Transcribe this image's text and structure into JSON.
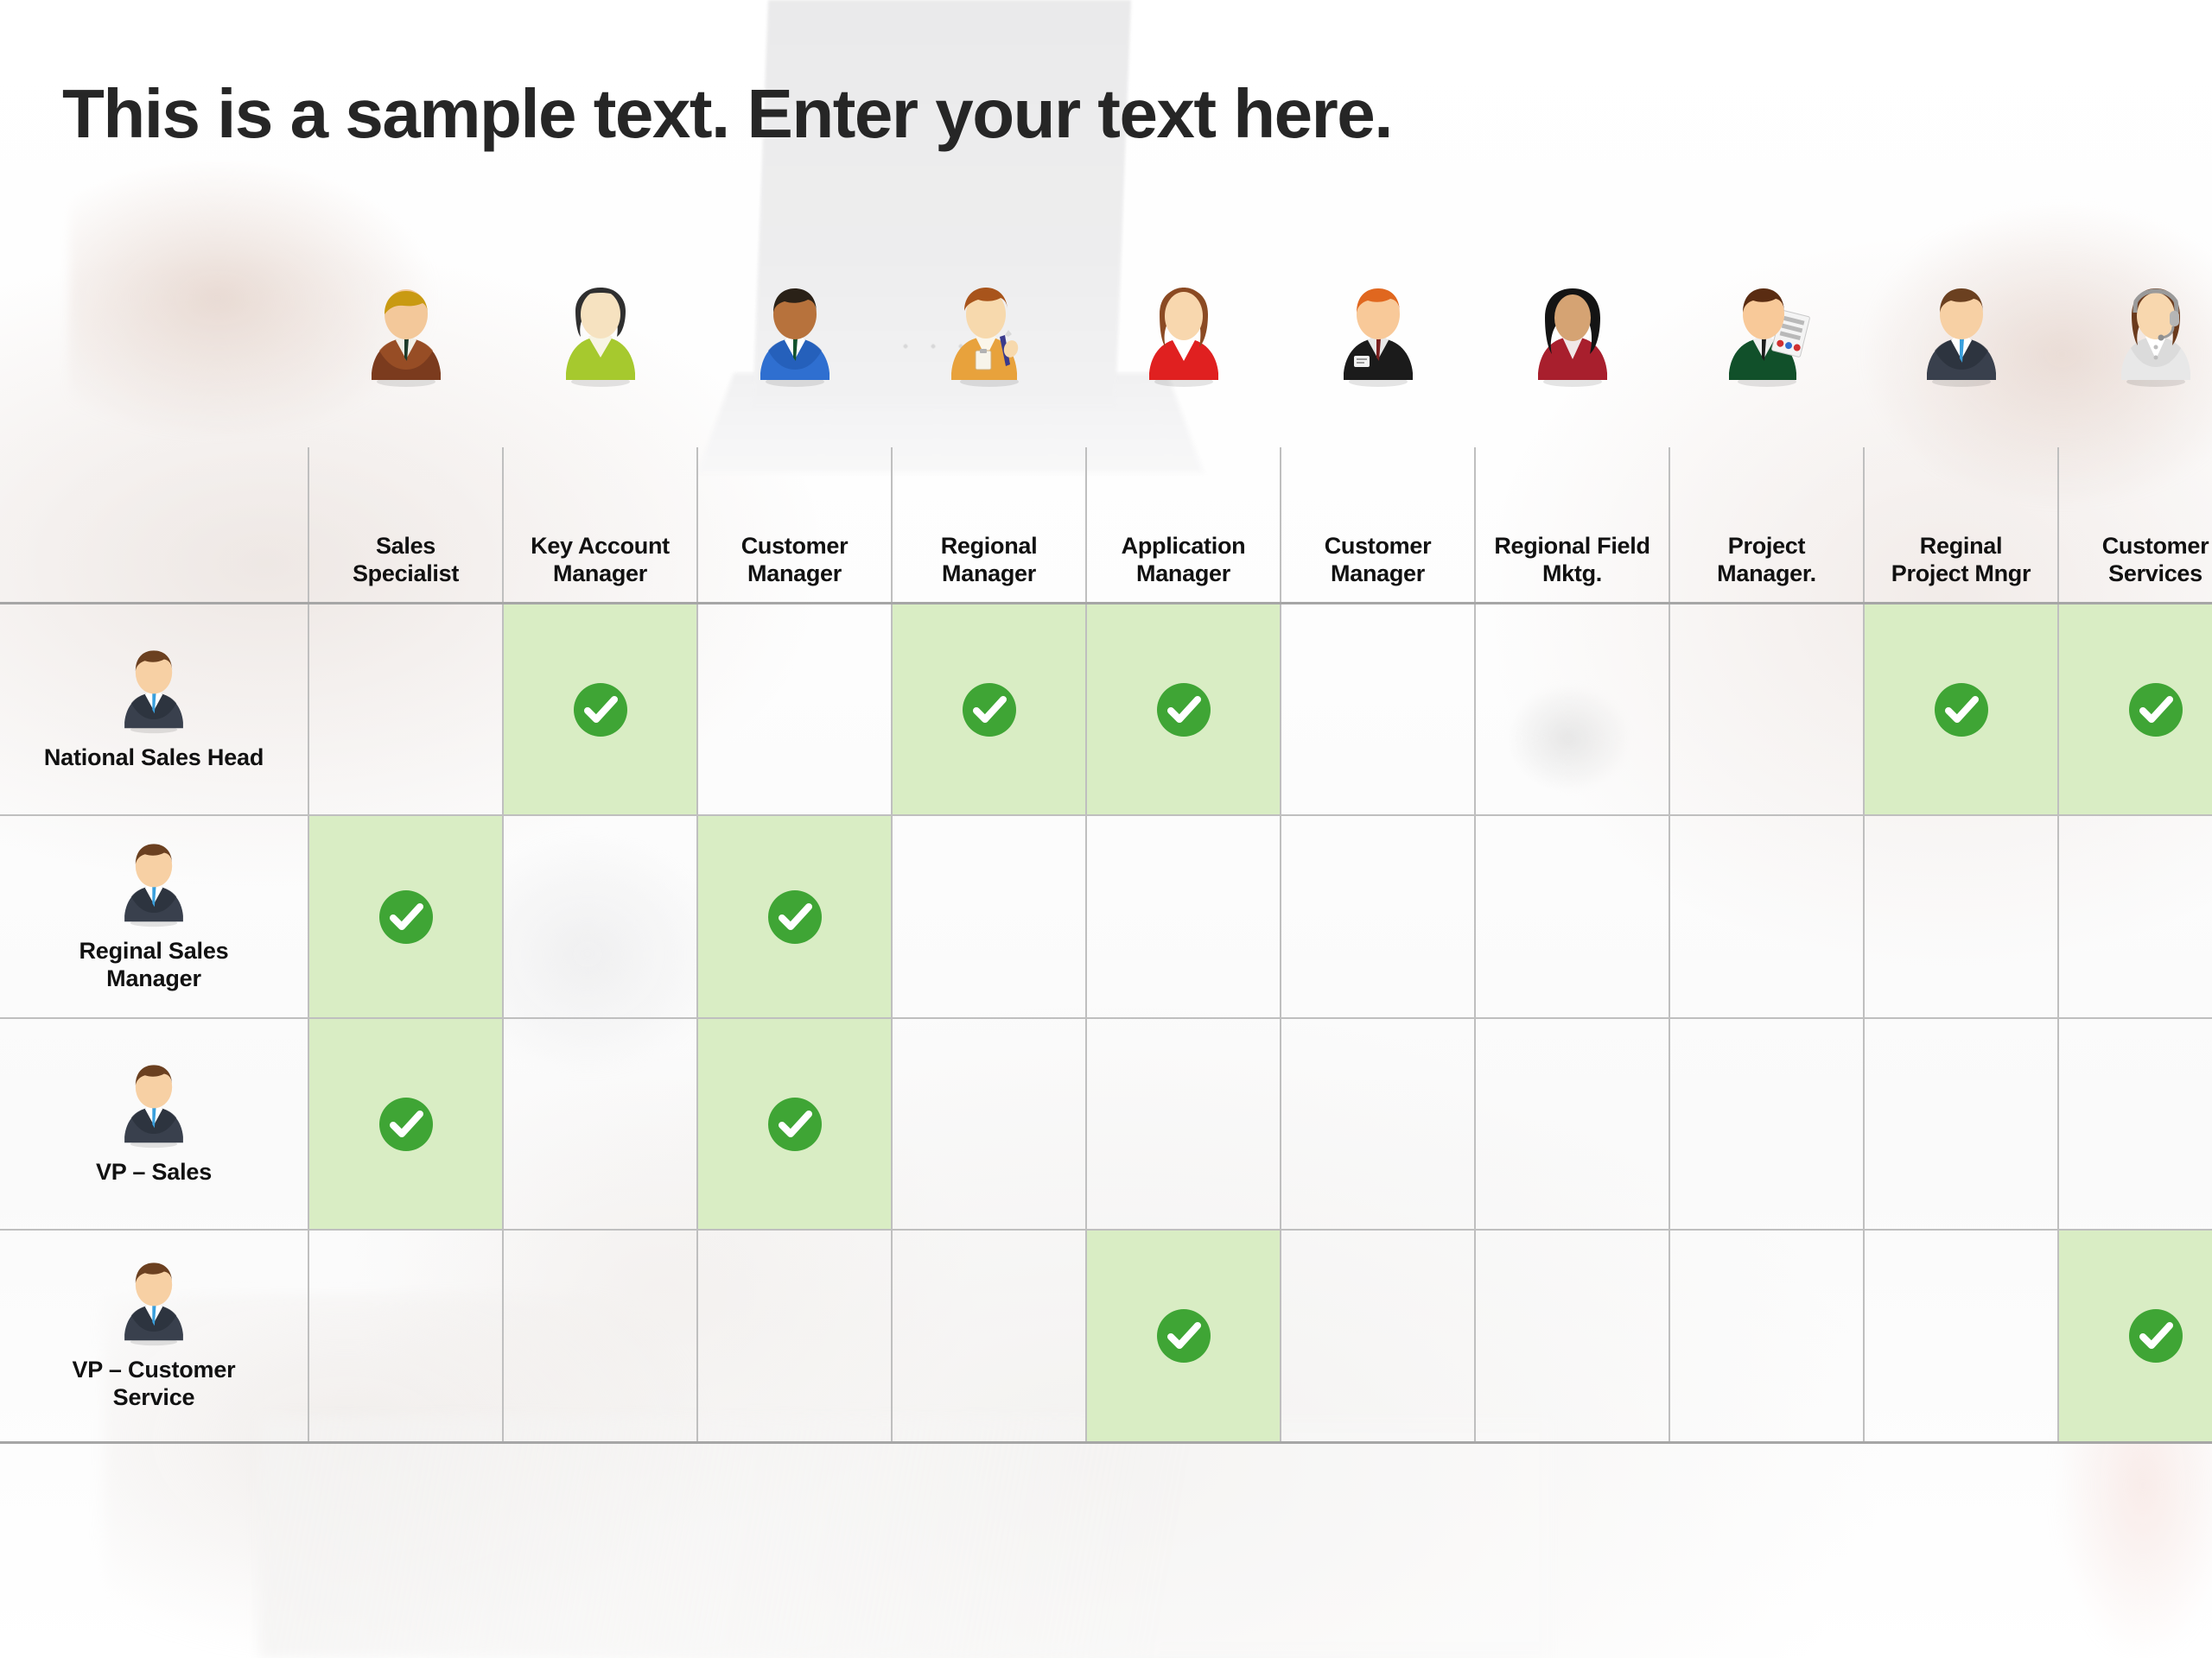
{
  "slide": {
    "title": "This is a sample text. Enter your text here."
  },
  "matrix": {
    "columns": [
      {
        "label": "Sales\nSpecialist",
        "label_line1": "Sales",
        "label_line2": "Specialist",
        "icon": "person-male-brown-suit-icon",
        "hair": "#c99a12",
        "suit": "#7b3b1e",
        "suit2": "#a05428",
        "shirt": "#f2efe6",
        "tie": "#1d3b2a",
        "skin": "#f3c89a"
      },
      {
        "label": "Key Account\nManager",
        "label_line1": "Key Account",
        "label_line2": "Manager",
        "icon": "person-female-green-top-icon",
        "hair": "#2f2f2f",
        "suit": "#a6c92e",
        "suit2": "#8fb223",
        "shirt": "#f7f4e4",
        "tie": "",
        "skin": "#f6e2c0"
      },
      {
        "label": "Customer\nManager",
        "label_line1": "Customer",
        "label_line2": "Manager",
        "icon": "person-male-blue-suit-icon",
        "hair": "#2a2117",
        "suit": "#2f6fd0",
        "suit2": "#1f57ad",
        "shirt": "#ffffff",
        "tie": "#14532d",
        "skin": "#b7723c"
      },
      {
        "label": "Regional\nManager",
        "label_line1": "Regional",
        "label_line2": "Manager",
        "icon": "person-female-clipboard-icon",
        "hair": "#a8541b",
        "suit": "#e8a23c",
        "suit2": "#cf8b28",
        "shirt": "#fbf6ea",
        "tie": "",
        "skin": "#f7d9ad"
      },
      {
        "label": "Application\nManager",
        "label_line1": "Application",
        "label_line2": "Manager",
        "icon": "person-female-red-top-icon",
        "hair": "#8b4a23",
        "suit": "#e02020",
        "suit2": "#b81616",
        "shirt": "#ffffff",
        "tie": "",
        "skin": "#f8d7ae"
      },
      {
        "label": "Customer\nManager",
        "label_line1": "Customer",
        "label_line2": "Manager",
        "icon": "person-male-black-suit-badge-icon",
        "hair": "#e0671f",
        "suit": "#1b1b1b",
        "suit2": "#000000",
        "shirt": "#e8e8e8",
        "tie": "#7a1f1f",
        "skin": "#f8c999"
      },
      {
        "label": "Regional Field\nMktg.",
        "label_line1": "Regional Field",
        "label_line2": "Mktg.",
        "icon": "person-female-dark-hair-icon",
        "hair": "#141414",
        "suit": "#a81f2d",
        "suit2": "#7d1420",
        "shirt": "#f0e7e7",
        "tie": "",
        "skin": "#d5a373"
      },
      {
        "label": "Project\nManager.",
        "label_line1": "Project",
        "label_line2": "Manager.",
        "icon": "person-male-green-suit-chart-icon",
        "hair": "#5a2c12",
        "suit": "#11502a",
        "suit2": "#0b3b1e",
        "shirt": "#efefef",
        "tie": "#1c1c1c",
        "skin": "#f8c999"
      },
      {
        "label": "Reginal\nProject Mngr",
        "label_line1": "Reginal",
        "label_line2": "Project Mngr",
        "icon": "person-male-navy-suit-icon",
        "hair": "#6b4020",
        "suit": "#39404d",
        "suit2": "#242a34",
        "shirt": "#ffffff",
        "tie": "#3aa0dd",
        "skin": "#f7d0a4"
      },
      {
        "label": "Customer\nServices",
        "label_line1": "Customer",
        "label_line2": "Services",
        "icon": "person-female-headset-icon",
        "hair": "#6b3a1c",
        "suit": "#e8e8e8",
        "suit2": "#cfcfcf",
        "shirt": "#ffffff",
        "tie": "",
        "skin": "#f8d7ae"
      }
    ],
    "rows": [
      {
        "label": "National Sales Head",
        "label_line1": "National Sales Head",
        "label_line2": "",
        "icon": "person-male-navy-suit-icon"
      },
      {
        "label": "Reginal Sales Manager",
        "label_line1": "Reginal Sales",
        "label_line2": "Manager",
        "icon": "person-male-navy-suit-icon"
      },
      {
        "label": "VP – Sales",
        "label_line1": "VP – Sales",
        "label_line2": "",
        "icon": "person-male-navy-suit-icon"
      },
      {
        "label": "VP – Customer Service",
        "label_line1": "VP – Customer",
        "label_line2": "Service",
        "icon": "person-male-navy-suit-icon"
      }
    ],
    "cells": [
      [
        false,
        true,
        false,
        true,
        true,
        false,
        false,
        false,
        true,
        true
      ],
      [
        true,
        false,
        true,
        false,
        false,
        false,
        false,
        false,
        false,
        false
      ],
      [
        true,
        false,
        true,
        false,
        false,
        false,
        false,
        false,
        false,
        false
      ],
      [
        false,
        false,
        false,
        false,
        true,
        false,
        false,
        false,
        false,
        true
      ]
    ],
    "check_icon": "check-circle-icon",
    "colors": {
      "check_circle": "#3FA535",
      "check_mark": "#ffffff",
      "cell_highlight": "#d9edc4",
      "grid_line": "#bfbfbf",
      "text": "#111111",
      "title": "#262626"
    }
  }
}
